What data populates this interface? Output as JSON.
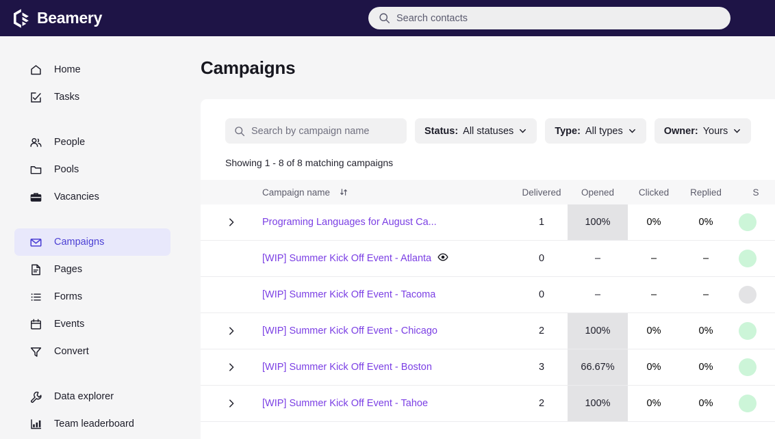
{
  "topbar": {
    "brand": "Beamery",
    "logo_icon": "beamery-hex-logo",
    "search": {
      "placeholder": "Search contacts",
      "value": "",
      "icon": "search-icon"
    }
  },
  "sidebar": {
    "items": [
      {
        "label": "Home",
        "icon": "home-icon",
        "active": false
      },
      {
        "label": "Tasks",
        "icon": "task-check-icon",
        "active": false
      },
      {
        "label": "People",
        "icon": "people-icon",
        "active": false
      },
      {
        "label": "Pools",
        "icon": "folder-icon",
        "active": false
      },
      {
        "label": "Vacancies",
        "icon": "briefcase-icon",
        "active": false
      },
      {
        "label": "Campaigns",
        "icon": "envelope-icon",
        "active": true
      },
      {
        "label": "Pages",
        "icon": "document-icon",
        "active": false
      },
      {
        "label": "Forms",
        "icon": "list-icon",
        "active": false
      },
      {
        "label": "Events",
        "icon": "calendar-icon",
        "active": false
      },
      {
        "label": "Convert",
        "icon": "funnel-icon",
        "active": false
      },
      {
        "label": "Data explorer",
        "icon": "wrench-icon",
        "active": false
      },
      {
        "label": "Team leaderboard",
        "icon": "bar-chart-icon",
        "active": false
      }
    ]
  },
  "page": {
    "title": "Campaigns",
    "results_text": "Showing 1 - 8 of 8 matching campaigns"
  },
  "filters": {
    "search": {
      "placeholder": "Search by campaign name",
      "value": "",
      "icon": "search-icon"
    },
    "status": {
      "label": "Status:",
      "value": "All statuses",
      "icon": "chevron-down-icon"
    },
    "type": {
      "label": "Type:",
      "value": "All types",
      "icon": "chevron-down-icon"
    },
    "owner": {
      "label": "Owner:",
      "value": "Yours",
      "icon": "chevron-down-icon"
    }
  },
  "table": {
    "columns": {
      "name": "Campaign name",
      "delivered": "Delivered",
      "opened": "Opened",
      "clicked": "Clicked",
      "replied": "Replied",
      "status": "S"
    },
    "sort_icon": "sort-updown-icon",
    "rows": [
      {
        "expandable": true,
        "expand_icon": "chevron-right-icon",
        "name": "Programing Languages for August Ca...",
        "eye": false,
        "delivered": "1",
        "opened": "100%",
        "opened_highlight": true,
        "clicked": "0%",
        "replied": "0%",
        "status_color": "green"
      },
      {
        "expandable": false,
        "expand_icon": "",
        "name": "[WIP] Summer Kick Off Event - Atlanta",
        "eye": true,
        "eye_icon": "eye-icon",
        "delivered": "0",
        "opened": "–",
        "opened_highlight": false,
        "clicked": "–",
        "replied": "–",
        "status_color": "green"
      },
      {
        "expandable": false,
        "expand_icon": "",
        "name": "[WIP] Summer Kick Off Event - Tacoma",
        "eye": false,
        "delivered": "0",
        "opened": "–",
        "opened_highlight": false,
        "clicked": "–",
        "replied": "–",
        "status_color": "gray"
      },
      {
        "expandable": true,
        "expand_icon": "chevron-right-icon",
        "name": "[WIP] Summer Kick Off Event - Chicago",
        "eye": false,
        "delivered": "2",
        "opened": "100%",
        "opened_highlight": true,
        "clicked": "0%",
        "replied": "0%",
        "status_color": "green"
      },
      {
        "expandable": true,
        "expand_icon": "chevron-right-icon",
        "name": "[WIP] Summer Kick Off Event - Boston",
        "eye": false,
        "delivered": "3",
        "opened": "66.67%",
        "opened_highlight": true,
        "clicked": "0%",
        "replied": "0%",
        "status_color": "green"
      },
      {
        "expandable": true,
        "expand_icon": "chevron-right-icon",
        "name": "[WIP] Summer Kick Off Event - Tahoe",
        "eye": false,
        "delivered": "2",
        "opened": "100%",
        "opened_highlight": true,
        "clicked": "0%",
        "replied": "0%",
        "status_color": "green"
      }
    ]
  },
  "colors": {
    "navy": "#1e1446",
    "accent_purple": "#7b3fe4",
    "active_nav_bg": "#e8e8fb",
    "active_nav_fg": "#4b3fd4",
    "status_green": "#ccf5d8",
    "status_gray": "#e3e3e5"
  }
}
